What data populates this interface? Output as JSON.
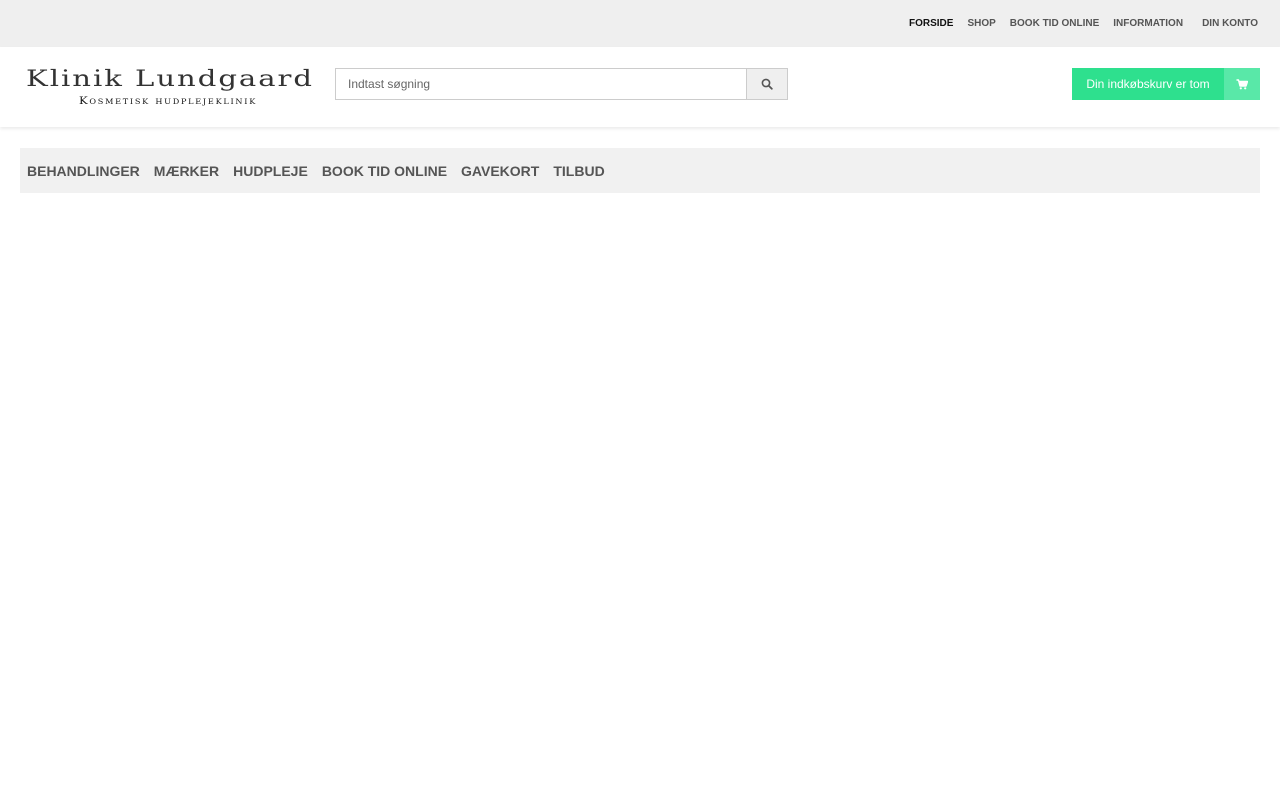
{
  "topnav": {
    "items": [
      {
        "label": "FORSIDE",
        "active": true
      },
      {
        "label": "SHOP",
        "active": false
      },
      {
        "label": "BOOK TID ONLINE",
        "active": false
      },
      {
        "label": "INFORMATION",
        "active": false
      }
    ],
    "account_label": "DIN KONTO"
  },
  "logo": {
    "title": "Klinik Lundgaard",
    "subtitle": "Kosmetisk hudplejeklinik"
  },
  "search": {
    "placeholder": "Indtast søgning",
    "value": "",
    "icon": "search-icon"
  },
  "cart": {
    "label": "Din indkøbskurv er tom",
    "icon": "cart-icon",
    "color": "#2ee08e",
    "icon_bg_color": "#59e8a8"
  },
  "mainnav": {
    "items": [
      {
        "label": "BEHANDLINGER"
      },
      {
        "label": "MÆRKER"
      },
      {
        "label": "HUDPLEJE"
      },
      {
        "label": "BOOK TID ONLINE"
      },
      {
        "label": "GAVEKORT"
      },
      {
        "label": "TILBUD"
      }
    ]
  }
}
